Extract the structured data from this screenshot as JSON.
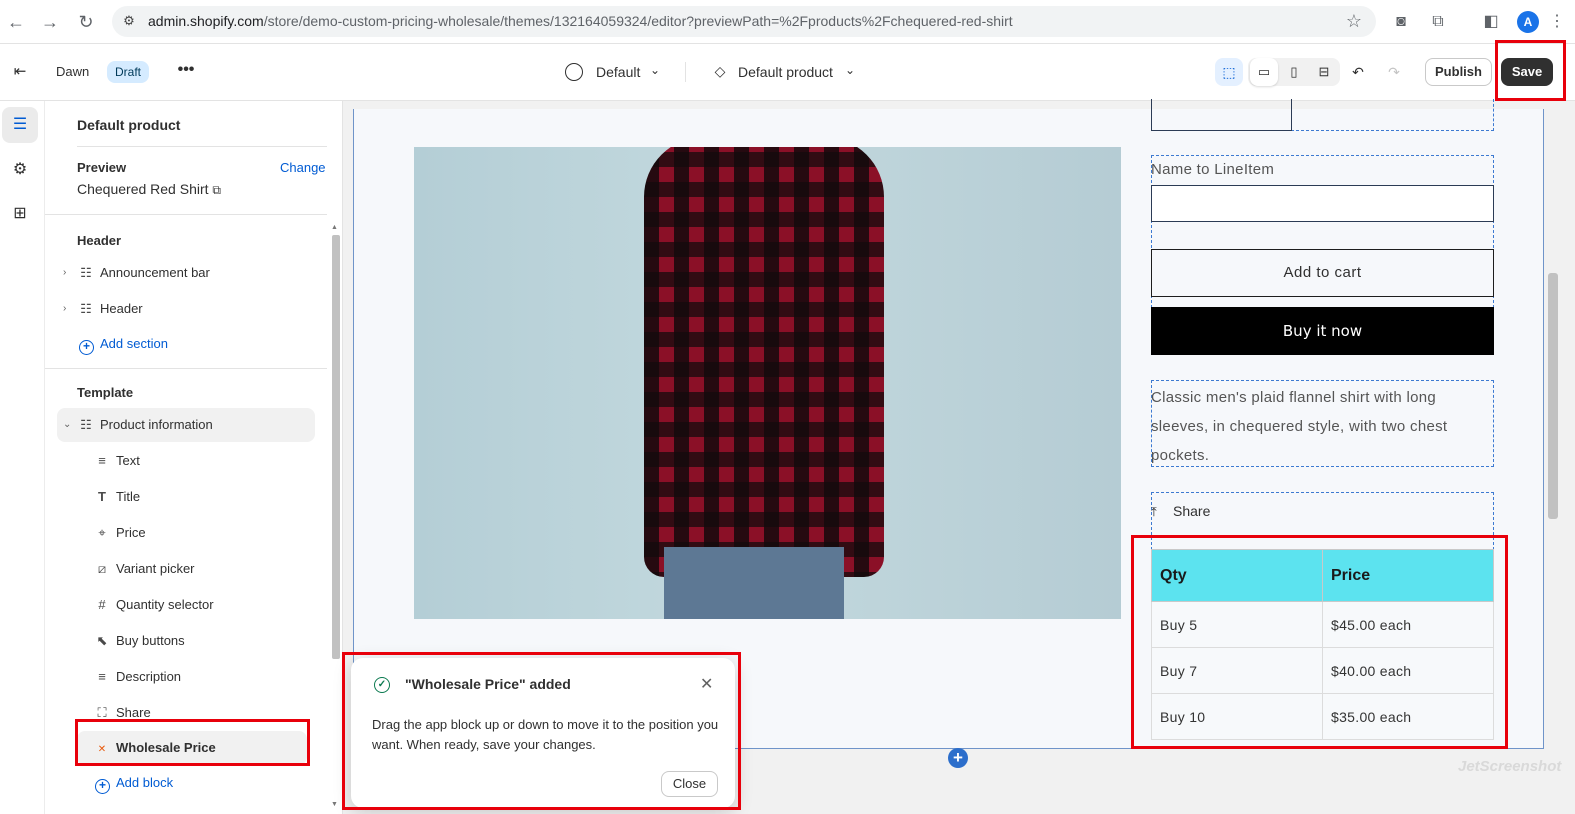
{
  "browser": {
    "url_host": "admin.shopify.com",
    "url_path": "/store/demo-custom-pricing-wholesale/themes/132164059324/editor?previewPath=%2Fproducts%2Fchequered-red-shirt",
    "avatar_letter": "A"
  },
  "topbar": {
    "theme_name": "Dawn",
    "status_badge": "Draft",
    "more": "•••",
    "template_select": "Default",
    "product_select": "Default product",
    "publish_label": "Publish",
    "save_label": "Save"
  },
  "sidebar": {
    "title": "Default product",
    "preview_label": "Preview",
    "change_link": "Change",
    "preview_product": "Chequered Red Shirt",
    "header_group": "Header",
    "header_items": [
      {
        "label": "Announcement bar",
        "icon": "section-icon"
      },
      {
        "label": "Header",
        "icon": "section-icon"
      }
    ],
    "add_section": "Add section",
    "template_group": "Template",
    "template_section": "Product information",
    "blocks": [
      {
        "label": "Text",
        "icon": "text-lines-icon"
      },
      {
        "label": "Title",
        "icon": "title-t-icon"
      },
      {
        "label": "Price",
        "icon": "price-tag-icon"
      },
      {
        "label": "Variant picker",
        "icon": "variant-icon"
      },
      {
        "label": "Quantity selector",
        "icon": "hash-icon"
      },
      {
        "label": "Buy buttons",
        "icon": "cursor-icon"
      },
      {
        "label": "Description",
        "icon": "text-lines-icon"
      },
      {
        "label": "Share",
        "icon": "share-icon"
      },
      {
        "label": "Wholesale Price",
        "icon": "app-logo-icon"
      }
    ],
    "add_block": "Add block"
  },
  "preview": {
    "field_label": "Name to LineItem",
    "add_to_cart": "Add to cart",
    "buy_now": "Buy it now",
    "description": "Classic men's plaid flannel shirt with long sleeves, in chequered style, with two chest pockets.",
    "share_label": "Share",
    "table": {
      "headers": [
        "Qty",
        "Price"
      ],
      "rows": [
        [
          "Buy 5",
          "$45.00 each"
        ],
        [
          "Buy 7",
          "$40.00 each"
        ],
        [
          "Buy 10",
          "$35.00 each"
        ]
      ],
      "header_color": "#5ce3ef"
    }
  },
  "toast": {
    "title": "\"Wholesale Price\" added",
    "body": "Drag the app block up or down to move it to the position you want. When ready, save your changes.",
    "close_label": "Close"
  },
  "watermark": "JetScreenshot",
  "colors": {
    "accent": "#005bd3",
    "highlight": "#e8000b",
    "save": "#303030"
  }
}
